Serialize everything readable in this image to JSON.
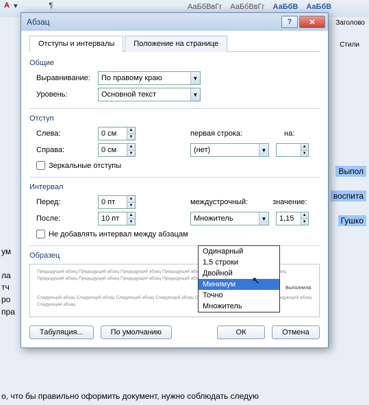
{
  "background": {
    "styles_preview": [
      "АаБбВвГг",
      "АаБбВвГг",
      "АаБбВ",
      "АаБбВ"
    ],
    "right_label_1": "Заголово",
    "right_label_2": "Стили",
    "doc_fragments": [
      "ум",
      "ла",
      "тч",
      "ро",
      "пра"
    ],
    "doc_highlights": [
      "Выпол",
      "воспита",
      "Гушко "
    ],
    "bottom_text": "о, что бы правильно оформить документ, нужно соблюдать следую"
  },
  "dialog": {
    "title": "Абзац",
    "tabs": {
      "t1": "Отступы и интервалы",
      "t2": "Положение на странице"
    },
    "sec_general": "Общие",
    "align_label": "Выравнивание:",
    "align_value": "По правому краю",
    "level_label": "Уровень:",
    "level_value": "Основной текст",
    "sec_indent": "Отступ",
    "left_label": "Слева:",
    "left_value": "0 см",
    "right_label": "Справа:",
    "right_value": "0 см",
    "first_line_label": "первая строка:",
    "first_line_value": "(нет)",
    "by_label": "на:",
    "by_value": "",
    "mirror_label": "Зеркальные отступы",
    "sec_spacing": "Интервал",
    "before_label": "Перед:",
    "before_value": "0 пт",
    "after_label": "После:",
    "after_value": "10 пт",
    "line_spacing_label": "междустрочный:",
    "line_spacing_value": "Множитель",
    "value_label": "значение:",
    "value_value": "1,15",
    "no_space_label": "Не добавлять интервал между абзацам",
    "sec_preview": "Образец",
    "preview_line_prev": "Предыдущий абзац Предыдущий абзац Предыдущий абзац Предыдущий абзац Предыдущий абзац Предыдущий абзац Предыдущий абзац Предыдущий абзац Предыдущий абзац Предыдущий абзац Предыдущий абзац",
    "preview_sample": "Выполнила:",
    "preview_line_next": "Следующий абзац Следующий абзац Следующий абзац Следующий абзац Следующий абзац Следующий абзац Следующий абзац Следующий абзац",
    "btn_tabs": "Табуляция...",
    "btn_default": "По умолчанию",
    "btn_ok": "ОК",
    "btn_cancel": "Отмена"
  },
  "dropdown": {
    "items": [
      "Одинарный",
      "1,5 строки",
      "Двойной",
      "Минимум",
      "Точно",
      "Множитель"
    ],
    "selected_index": 3
  }
}
